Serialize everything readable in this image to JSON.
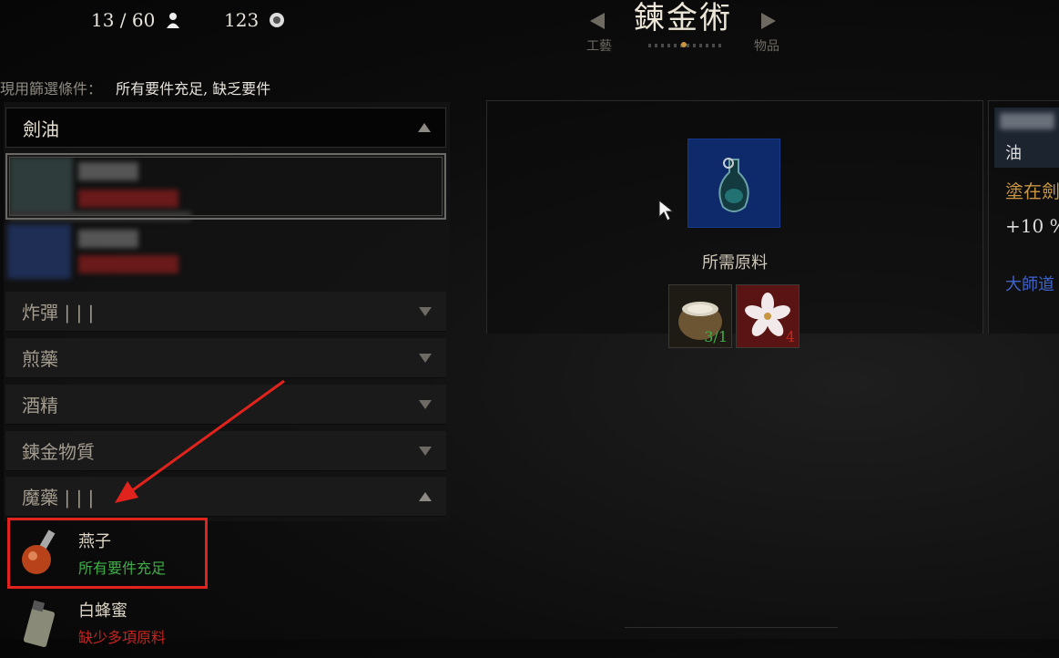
{
  "header": {
    "inventory_count": "13 / 60",
    "currency": "123",
    "title": "鍊金術",
    "tab_left": "工藝",
    "tab_right": "物品"
  },
  "filter": {
    "label": "現用篩選條件：",
    "value": "所有要件充足, 缺乏要件"
  },
  "categories": [
    {
      "label": "劍油",
      "state": "expanded"
    },
    {
      "label": "炸彈 | | |",
      "state": "collapsed"
    },
    {
      "label": "煎藥",
      "state": "collapsed"
    },
    {
      "label": "酒精",
      "state": "collapsed"
    },
    {
      "label": "鍊金物質",
      "state": "collapsed"
    },
    {
      "label": "魔藥 | | |",
      "state": "expanded"
    }
  ],
  "recipes": [
    {
      "name": "燕子",
      "status": "所有要件充足",
      "status_color": "#3fae47"
    },
    {
      "name": "白蜂蜜",
      "status": "缺少多項原料",
      "status_color": "#c2261e"
    }
  ],
  "detail": {
    "ingredients_label": "所需原料",
    "ingredients": [
      {
        "icon": "jar-icon",
        "count": "3/1",
        "count_color": "#3fae47"
      },
      {
        "icon": "flower-icon",
        "count": "4",
        "count_color": "#c2261e"
      }
    ]
  },
  "right_panel": {
    "title_fragment": "油",
    "desc_fragment": "塗在劍",
    "bonus_fragment": "+10 %",
    "mastery_fragment": "大師道"
  },
  "colors": {
    "highlight": "#e0231c",
    "accent_gold": "#c89640",
    "ok_green": "#3fae47",
    "missing_red": "#c2261e"
  }
}
